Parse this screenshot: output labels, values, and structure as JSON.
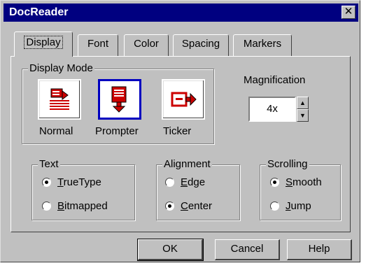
{
  "window": {
    "title": "DocReader"
  },
  "tabs": [
    {
      "label": "Display",
      "active": true
    },
    {
      "label": "Font"
    },
    {
      "label": "Color"
    },
    {
      "label": "Spacing"
    },
    {
      "label": "Markers"
    }
  ],
  "display_mode": {
    "label": "Display Mode",
    "modes": [
      {
        "label": "Normal",
        "icon": "normal-mode-icon"
      },
      {
        "label": "Prompter",
        "icon": "prompter-mode-icon",
        "selected": true
      },
      {
        "label": "Ticker",
        "icon": "ticker-mode-icon"
      }
    ]
  },
  "magnification": {
    "label": "Magnification",
    "value": "4x"
  },
  "text_group": {
    "label": "Text",
    "options": [
      {
        "label": "TrueType",
        "accel": "T",
        "checked": true
      },
      {
        "label": "Bitmapped",
        "accel": "B",
        "checked": false
      }
    ]
  },
  "alignment_group": {
    "label": "Alignment",
    "options": [
      {
        "label": "Edge",
        "accel": "E",
        "checked": false
      },
      {
        "label": "Center",
        "accel": "C",
        "checked": true
      }
    ]
  },
  "scrolling_group": {
    "label": "Scrolling",
    "options": [
      {
        "label": "Smooth",
        "accel": "S",
        "checked": true
      },
      {
        "label": "Jump",
        "accel": "J",
        "checked": false
      }
    ]
  },
  "buttons": {
    "ok": "OK",
    "cancel": "Cancel",
    "help": "Help"
  },
  "colors": {
    "titlebar": "#000080",
    "face": "#c0c0c0",
    "icon_red": "#cc0000",
    "selected_border": "#0000c0"
  }
}
